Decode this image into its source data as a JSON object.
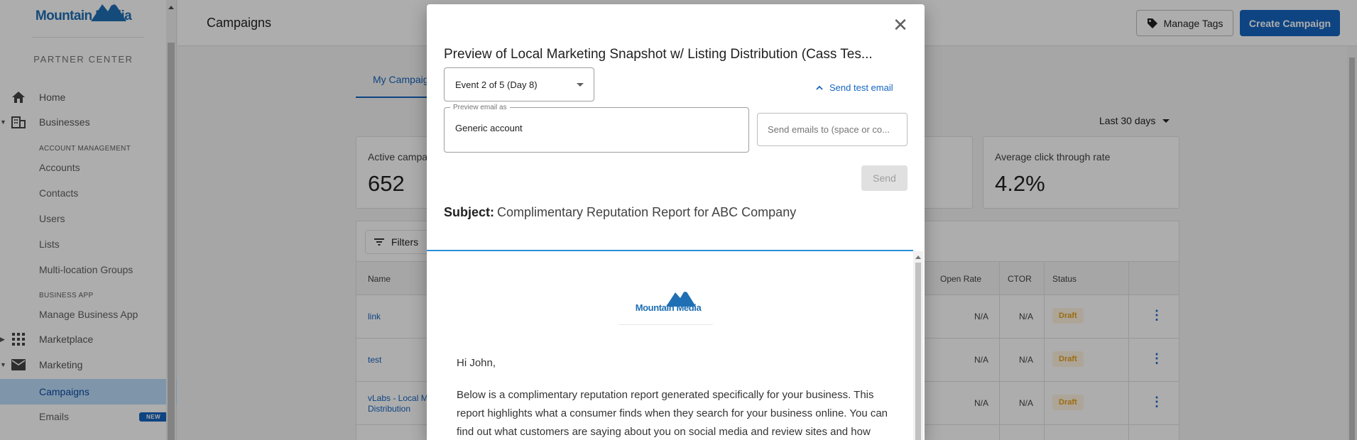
{
  "sidebar": {
    "logo": "Mountain Media",
    "partner_center": "PARTNER CENTER",
    "items": {
      "home": "Home",
      "businesses": "Businesses",
      "account_management": "ACCOUNT MANAGEMENT",
      "accounts": "Accounts",
      "contacts": "Contacts",
      "users": "Users",
      "lists": "Lists",
      "multi_location": "Multi-location Groups",
      "business_app": "BUSINESS APP",
      "manage_business_app": "Manage Business App",
      "marketplace": "Marketplace",
      "marketing": "Marketing",
      "campaigns": "Campaigns",
      "emails": "Emails",
      "new_badge": "NEW"
    }
  },
  "header": {
    "title": "Campaigns",
    "manage_tags": "Manage Tags",
    "create_campaign": "Create Campaign"
  },
  "main": {
    "tab_my_campaigns": "My Campaign",
    "date_range": "Last 30 days",
    "stats": {
      "active_label": "Active campa",
      "active_value": "652",
      "ctr_label": "Average click through rate",
      "ctr_value": "4.2%"
    },
    "filters": "Filters",
    "columns": {
      "name": "Name",
      "open_rate": "Open Rate",
      "ctor": "CTOR",
      "status": "Status"
    },
    "rows": [
      {
        "name": "link",
        "open_rate": "N/A",
        "ctor": "N/A",
        "status": "Draft"
      },
      {
        "name": "test",
        "open_rate": "N/A",
        "ctor": "N/A",
        "status": "Draft"
      },
      {
        "name": "vLabs - Local M",
        "name2": "Distribution",
        "open_rate": "N/A",
        "ctor": "N/A",
        "status": "Draft"
      }
    ]
  },
  "modal": {
    "title": "Preview of Local Marketing Snapshot w/ Listing Distribution (Cass Tes...",
    "event_select": "Event 2 of 5 (Day 8)",
    "send_test_email": "Send test email",
    "preview_email_label": "Preview email as",
    "preview_email_value": "Generic account",
    "send_emails_placeholder": "Send emails to (space or co...",
    "send_button": "Send",
    "subject_label": "Subject:",
    "subject_value": "Complimentary Reputation Report for ABC Company",
    "email": {
      "logo": "Mountain Media",
      "greeting": "Hi John,",
      "body": "Below is a complimentary reputation report generated specifically for your business. This report highlights what a consumer finds when they search for your business online. You can find out what customers are saying about you on social media and review sites and how you compare to your competition. Plus, find out where you're"
    }
  },
  "colors": {
    "primary": "#1565c0",
    "draft_text": "#e6a019",
    "draft_bg": "#fff3e0",
    "active_nav": "#bbdefb",
    "preview_rule": "#2a8fd6"
  }
}
